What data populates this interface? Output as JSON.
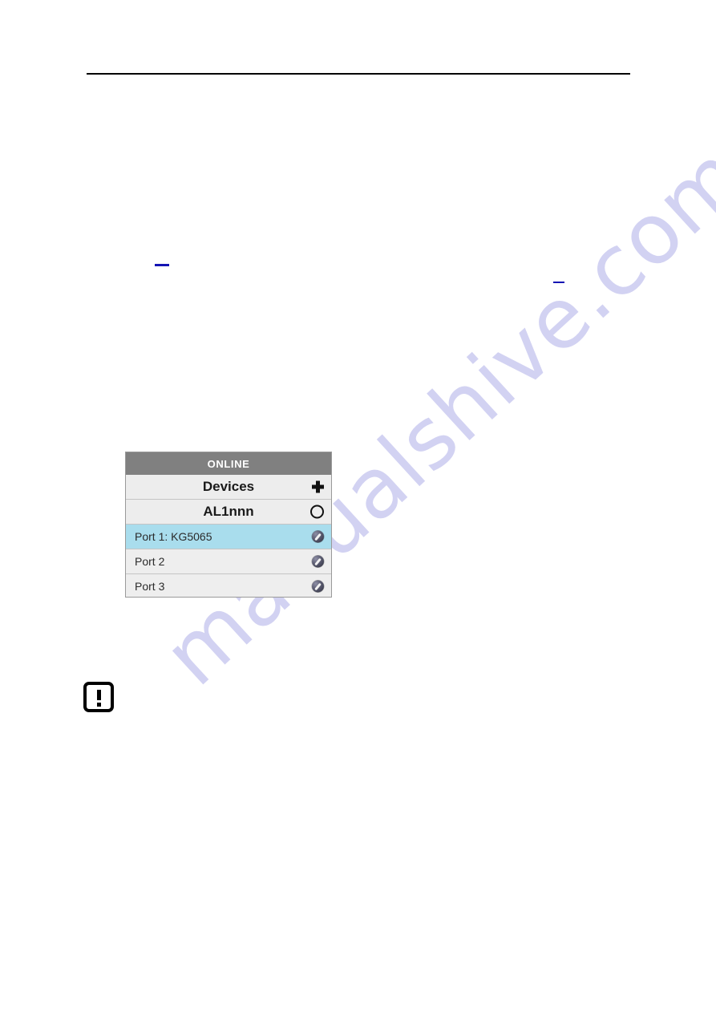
{
  "page": {
    "background_color": "#ffffff",
    "rule_color": "#000000"
  },
  "watermark": {
    "text": "manualshive.com",
    "color": "#d2d2f2"
  },
  "marks": {
    "link_dash_color": "#1414b4",
    "dash_upper_label": "—",
    "dash_lower_label": "—"
  },
  "notice": {
    "icon_name": "exclamation-box-icon",
    "glyph": "!"
  },
  "app_panel": {
    "title": "ONLINE",
    "title_bar_color": "#808080",
    "selection_color": "#a9dded",
    "rows": [
      {
        "label": "Devices",
        "kind": "group",
        "icon": "plus-icon",
        "selected": false
      },
      {
        "label": "AL1nnn",
        "kind": "group",
        "icon": "circle-outline-icon",
        "selected": false
      },
      {
        "label": "Port 1: KG5065",
        "kind": "leaf",
        "icon": "port-status-icon",
        "selected": true
      },
      {
        "label": "Port 2",
        "kind": "leaf",
        "icon": "port-status-icon",
        "selected": false
      },
      {
        "label": "Port 3",
        "kind": "leaf",
        "icon": "port-status-icon",
        "selected": false
      }
    ]
  }
}
